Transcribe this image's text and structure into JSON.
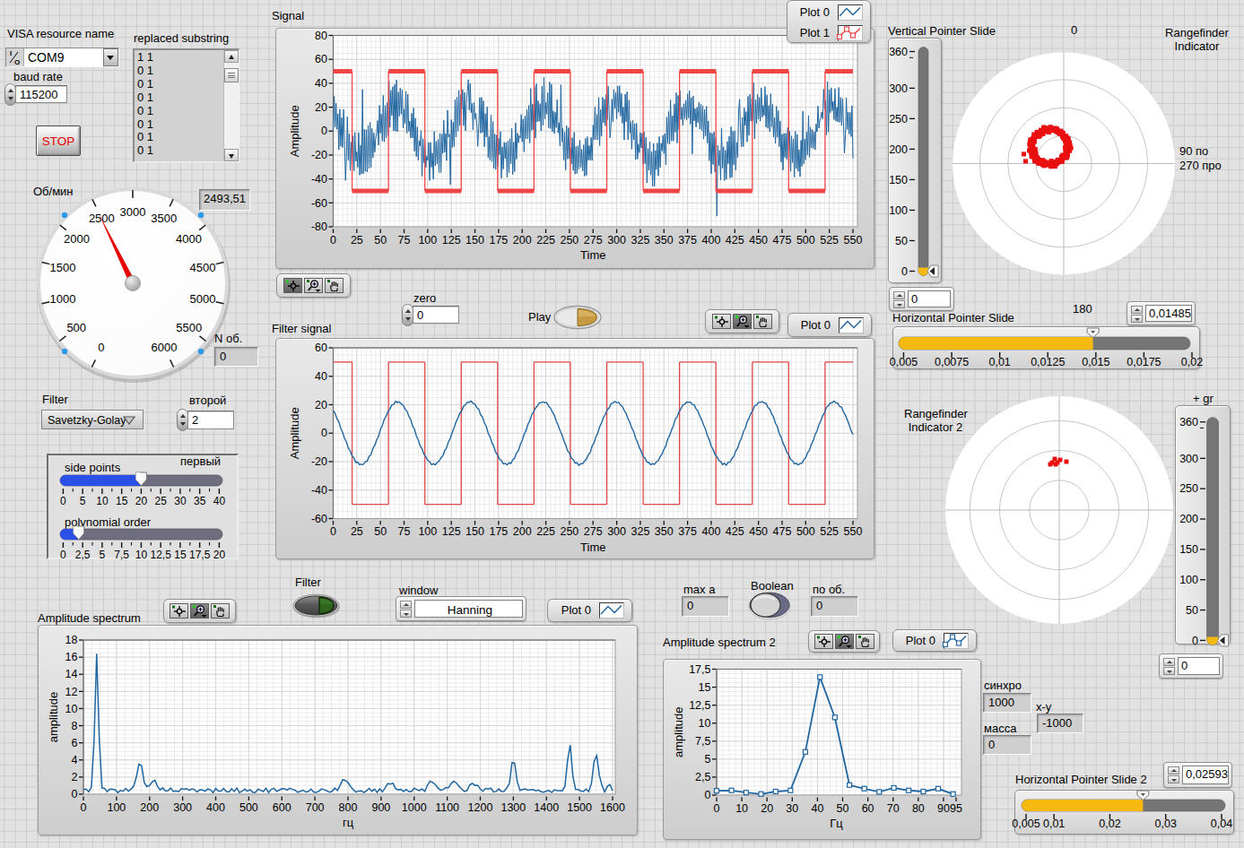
{
  "visa": {
    "label": "VISA resource name",
    "value": "COM9",
    "io_icon": "io-icon"
  },
  "baud": {
    "label": "baud rate",
    "value": "115200"
  },
  "stop": {
    "label": "STOP",
    "text_color": "#e60000"
  },
  "replaced": {
    "label": "replaced substring",
    "items": [
      "1 1",
      "0 1",
      "0 1",
      "0 1",
      "0 1",
      "0 1",
      "0 1",
      "0 1"
    ]
  },
  "gauge": {
    "label": "Об/мин",
    "display": "2493,51",
    "value": 2493.51,
    "min": 0,
    "max": 6000,
    "label_step": 500,
    "start_angle": -154,
    "end_angle": 154,
    "needle_color": "#e60000",
    "dot_color": "#2f99ec"
  },
  "n_ob": {
    "label": "N об.",
    "value": "0"
  },
  "filter_select": {
    "label": "Filter",
    "value": "Savetzky-Golay"
  },
  "vtoroy": {
    "label": "второй",
    "value": "2"
  },
  "slider_group": {
    "caption": "первый",
    "side_points": {
      "label": "side points",
      "min": 0,
      "max": 40,
      "value": 20,
      "tick_labels": [
        "0",
        "5",
        "10",
        "15",
        "20",
        "25",
        "30",
        "35",
        "40"
      ],
      "fill_color": "#2b50e8",
      "rest_color": "#6e6e7e"
    },
    "poly_order": {
      "label": "polynomial order",
      "min": 0,
      "max": 20,
      "value": 2,
      "tick_labels": [
        "0",
        "2,5",
        "5",
        "7,5",
        "10",
        "12,5",
        "15",
        "17,5",
        "20"
      ],
      "fill_color": "#2b50e8",
      "rest_color": "#6e6e7e"
    }
  },
  "zero": {
    "label": "zero",
    "value": "0"
  },
  "play": {
    "label": "Play",
    "on_color": "#c3963c"
  },
  "filter_led": {
    "label": "Filter",
    "arrow_color": "#2e641e"
  },
  "window_combo": {
    "label": "window",
    "value": "Hanning"
  },
  "max_a": {
    "label": "max a",
    "value": "0"
  },
  "boolean": {
    "label": "Boolean",
    "body_color": "#6a6a86"
  },
  "po_ob": {
    "label": "по об.",
    "value": "0"
  },
  "vslide1": {
    "label": "Vertical Pointer Slide",
    "min": 0,
    "max": 360,
    "value": 0,
    "tick_labels": [
      "360",
      "300",
      "250",
      "200",
      "150",
      "100",
      "50",
      "0"
    ],
    "tick_values": [
      360,
      300,
      250,
      200,
      150,
      100,
      50,
      0
    ],
    "minor_tick": 350,
    "fill_color": "#f5b912",
    "track_color": "#757575",
    "spin_value": "0"
  },
  "vslide2": {
    "label": "+ gr",
    "min": 0,
    "max": 360,
    "value": 0,
    "tick_labels": [
      "360",
      "300",
      "250",
      "200",
      "150",
      "100",
      "50",
      "0"
    ],
    "tick_values": [
      360,
      300,
      250,
      200,
      150,
      100,
      50,
      0
    ],
    "minor_tick": 350,
    "fill_color": "#f5b912",
    "track_color": "#757575",
    "spin_value": "0"
  },
  "polar1": {
    "title_line1": "Rangefinder",
    "title_line2": "Indicator",
    "top_label": "0",
    "bottom_label": "180",
    "right_label1": "90 по",
    "right_label2": "270 про",
    "rings": [
      31.2,
      62.3,
      93.5
    ],
    "cluster": {
      "cx": -15.5,
      "cy": -18.5,
      "ring_radius": 20.5,
      "spread": 2.9,
      "count": 300,
      "dot": 5,
      "seed": 11,
      "outliers": [
        [
          -29,
          8
        ],
        [
          -27,
          16
        ],
        [
          -23,
          4
        ]
      ]
    },
    "dot_color": "#ea1010"
  },
  "polar2": {
    "title_line1": "Rangefinder",
    "title_line2": "Indicator 2",
    "rings": [
      33.2,
      66.5,
      99.7
    ],
    "dots": [
      [
        -8,
        -53
      ],
      [
        -5,
        -57
      ],
      [
        -2,
        -53
      ],
      [
        1,
        -56
      ],
      [
        8,
        -54
      ],
      [
        -10,
        -51
      ],
      [
        -4,
        -51
      ]
    ],
    "dot": 5,
    "dot_color": "#ea1010"
  },
  "hslide1": {
    "label": "Horizontal Pointer Slide",
    "min": 0.005,
    "max": 0.02,
    "value": 0.01485,
    "tick_labels": [
      "0,005",
      "0,0075",
      "0,01",
      "0,0125",
      "0,015",
      "0,0175",
      "0,02"
    ],
    "tick_values": [
      0.005,
      0.0075,
      0.01,
      0.0125,
      0.015,
      0.0175,
      0.02
    ],
    "fill_color": "#f5b912",
    "track_color": "#757575",
    "display": "0,014853"
  },
  "hslide2": {
    "label": "Horizontal Pointer Slide 2",
    "min": 0.005,
    "max": 0.04,
    "value": 0.02593,
    "tick_labels": [
      "0,005",
      "0,01",
      "0,02",
      "0,03",
      "0,04"
    ],
    "tick_values": [
      0.005,
      0.01,
      0.02,
      0.03,
      0.04
    ],
    "fill_color": "#f5b912",
    "track_color": "#757575",
    "display": "0,025936"
  },
  "sinhro": {
    "label": "синхро",
    "value": "1000"
  },
  "massa": {
    "label": "масса",
    "value": "0"
  },
  "xy": {
    "label": "x-y",
    "value": "-1000"
  },
  "chart_data": {
    "signal": {
      "type": "line",
      "title": "Signal",
      "xlabel": "Time",
      "ylabel": "Amplitude",
      "xlim": [
        0,
        550
      ],
      "ylim": [
        -80,
        80
      ],
      "x_major": 25,
      "x_minor": 5,
      "y_major": 20,
      "y_minor": 5,
      "grid": true,
      "legend_position": "top-right",
      "legend": [
        {
          "label": "Plot 0",
          "color": "#2066a0",
          "markers": false
        },
        {
          "label": "Plot 1",
          "color": "#f04545",
          "markers": true
        }
      ],
      "series": [
        {
          "name": "Plot 0",
          "kind": "noisy_sine",
          "color": "#2066a0",
          "width": 1,
          "amp": 22,
          "period": 77,
          "peak_x": 67,
          "noise": 14,
          "spike_prob": 0.022,
          "spike_amp": 34,
          "step": 1,
          "seed": 7
        },
        {
          "name": "Plot 1",
          "kind": "square",
          "color": "#f04545",
          "level": 50,
          "first_fall": 20,
          "half_period": 38.5,
          "h_width": 5,
          "v_width": 1.3,
          "start_high": true
        }
      ]
    },
    "filter_signal": {
      "type": "line",
      "title": "Filter signal",
      "xlabel": "Time",
      "ylabel": "Amplitude",
      "xlim": [
        0,
        550
      ],
      "ylim": [
        -60,
        60
      ],
      "x_major": 25,
      "x_minor": 5,
      "y_major": 20,
      "y_minor": 5,
      "grid": true,
      "legend_position": "top-right",
      "legend": [
        {
          "label": "Plot 0",
          "color": "#2066a0",
          "markers": false
        }
      ],
      "series": [
        {
          "name": "Plot 1",
          "kind": "square",
          "color": "#e04848",
          "level": 50,
          "first_fall": 20,
          "half_period": 38.5,
          "h_width": 1.3,
          "v_width": 1.3,
          "start_high": true
        },
        {
          "name": "Plot 0",
          "kind": "noisy_sine",
          "color": "#2066a0",
          "width": 1.4,
          "amp": 22,
          "period": 77,
          "peak_x": 68,
          "noise": 0.5,
          "spike_prob": 0,
          "spike_amp": 0,
          "step": 2,
          "seed": 21
        }
      ]
    },
    "spectrum": {
      "type": "line",
      "title": "Amplitude spectrum",
      "xlabel": "гц",
      "ylabel": "amplitude",
      "xlim": [
        0,
        1600
      ],
      "ylim": [
        0,
        18
      ],
      "x_major": 100,
      "x_minor": 25,
      "y_major": 2,
      "y_minor": 0.5,
      "grid": true,
      "legend_position": "top-right",
      "legend": [
        {
          "label": "Plot 0",
          "color": "#2066a0",
          "markers": false
        }
      ],
      "series": [
        {
          "name": "Plot 0",
          "kind": "spectrum",
          "color": "#2066a0",
          "width": 1.5,
          "step": 8,
          "seed": 5,
          "base": 0.35,
          "noise": 0.55,
          "peaks": [
            [
              40,
              8,
              15.9
            ],
            [
              170,
              12,
              3.4
            ],
            [
              210,
              20,
              1.0
            ],
            [
              790,
              13,
              1.4
            ],
            [
              930,
              16,
              0.9
            ],
            [
              1055,
              16,
              1.2
            ],
            [
              1125,
              18,
              1.0
            ],
            [
              1180,
              14,
              0.9
            ],
            [
              1300,
              11,
              3.6
            ],
            [
              1470,
              9,
              5.7
            ],
            [
              1550,
              11,
              4.4
            ],
            [
              1590,
              8,
              0.8
            ]
          ]
        }
      ]
    },
    "spectrum2": {
      "type": "line",
      "title": "Amplitude spectrum 2",
      "xlabel": "Гц",
      "ylabel": "amplitude",
      "xlim": [
        0,
        95
      ],
      "ylim": [
        0,
        17.5
      ],
      "x_major": 10,
      "x_minor": 2.5,
      "y_major": 2.5,
      "y_minor": 0.625,
      "x_tick_labels": [
        "0",
        "10",
        "20",
        "30",
        "40",
        "50",
        "60",
        "70",
        "80",
        "90",
        "95"
      ],
      "x_tick_values": [
        0,
        10,
        20,
        30,
        40,
        50,
        60,
        70,
        80,
        90,
        95
      ],
      "y_tick_labels": [
        "0",
        "2,5",
        "5",
        "7,5",
        "10",
        "12,5",
        "15",
        "17,5"
      ],
      "y_tick_values": [
        0,
        2.5,
        5,
        7.5,
        10,
        12.5,
        15,
        17.5
      ],
      "grid": true,
      "legend_position": "top-right",
      "legend": [
        {
          "label": "Plot 0",
          "color": "#2066a0",
          "markers": true
        }
      ],
      "series": [
        {
          "name": "Plot 0",
          "kind": "xy_markers",
          "color": "#2066a0",
          "width": 1.8,
          "marker": 5,
          "x": [
            0,
            5.9,
            11.7,
            17.6,
            23.4,
            29.3,
            35.2,
            41,
            46.9,
            52.7,
            58.6,
            64.5,
            70.3,
            76.2,
            82,
            87.9,
            93.8
          ],
          "y": [
            0.6,
            0.65,
            0.35,
            0.15,
            0.5,
            0.65,
            6.0,
            16.4,
            10.8,
            1.4,
            0.9,
            0.45,
            1.0,
            0.65,
            0.5,
            0.9,
            0.15
          ]
        }
      ]
    }
  }
}
